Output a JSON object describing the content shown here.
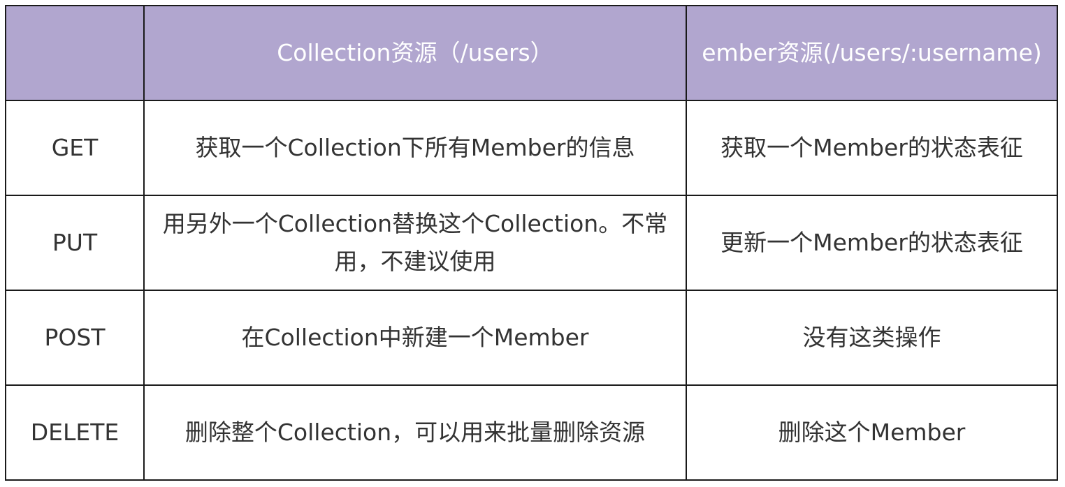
{
  "header": {
    "corner": "",
    "collection": "Collection资源（/users）",
    "member": "ember资源(/users/:username)"
  },
  "rows": [
    {
      "method": "GET",
      "collection": "获取一个Collection下所有Member的信息",
      "member": "获取一个Member的状态表征"
    },
    {
      "method": "PUT",
      "collection": "用另外一个Collection替换这个Collection。不常用，不建议使用",
      "member": "更新一个Member的状态表征"
    },
    {
      "method": "POST",
      "collection": "在Collection中新建一个Member",
      "member": "没有这类操作"
    },
    {
      "method": "DELETE",
      "collection": "删除整个Collection，可以用来批量删除资源",
      "member": "删除这个Member"
    }
  ],
  "colors": {
    "header_bg": "#b1a6cf",
    "header_text": "#ffffff",
    "border": "#1a1a1a",
    "body_text": "#333333"
  }
}
